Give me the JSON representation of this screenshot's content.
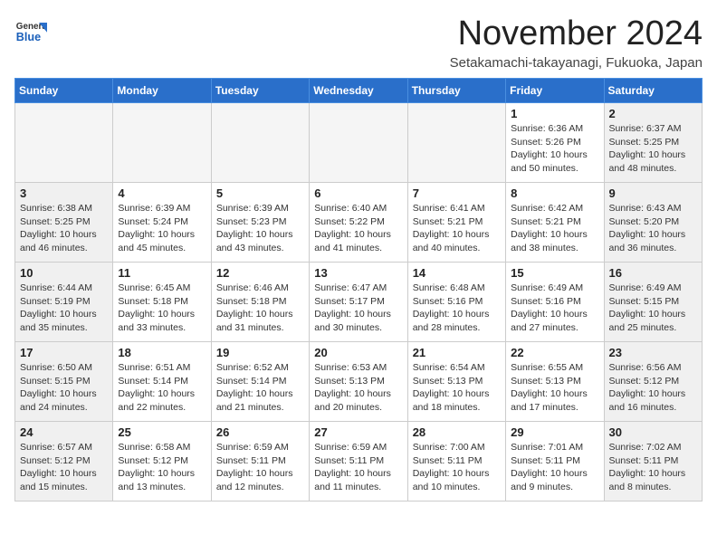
{
  "header": {
    "logo_general": "General",
    "logo_blue": "Blue",
    "month_title": "November 2024",
    "location": "Setakamachi-takayanagi, Fukuoka, Japan"
  },
  "days_of_week": [
    "Sunday",
    "Monday",
    "Tuesday",
    "Wednesday",
    "Thursday",
    "Friday",
    "Saturday"
  ],
  "weeks": [
    [
      {
        "day": "",
        "info": "",
        "empty": true
      },
      {
        "day": "",
        "info": "",
        "empty": true
      },
      {
        "day": "",
        "info": "",
        "empty": true
      },
      {
        "day": "",
        "info": "",
        "empty": true
      },
      {
        "day": "",
        "info": "",
        "empty": true
      },
      {
        "day": "1",
        "info": "Sunrise: 6:36 AM\nSunset: 5:26 PM\nDaylight: 10 hours and 50 minutes.",
        "empty": false
      },
      {
        "day": "2",
        "info": "Sunrise: 6:37 AM\nSunset: 5:25 PM\nDaylight: 10 hours and 48 minutes.",
        "empty": false
      }
    ],
    [
      {
        "day": "3",
        "info": "Sunrise: 6:38 AM\nSunset: 5:25 PM\nDaylight: 10 hours and 46 minutes.",
        "empty": false
      },
      {
        "day": "4",
        "info": "Sunrise: 6:39 AM\nSunset: 5:24 PM\nDaylight: 10 hours and 45 minutes.",
        "empty": false
      },
      {
        "day": "5",
        "info": "Sunrise: 6:39 AM\nSunset: 5:23 PM\nDaylight: 10 hours and 43 minutes.",
        "empty": false
      },
      {
        "day": "6",
        "info": "Sunrise: 6:40 AM\nSunset: 5:22 PM\nDaylight: 10 hours and 41 minutes.",
        "empty": false
      },
      {
        "day": "7",
        "info": "Sunrise: 6:41 AM\nSunset: 5:21 PM\nDaylight: 10 hours and 40 minutes.",
        "empty": false
      },
      {
        "day": "8",
        "info": "Sunrise: 6:42 AM\nSunset: 5:21 PM\nDaylight: 10 hours and 38 minutes.",
        "empty": false
      },
      {
        "day": "9",
        "info": "Sunrise: 6:43 AM\nSunset: 5:20 PM\nDaylight: 10 hours and 36 minutes.",
        "empty": false
      }
    ],
    [
      {
        "day": "10",
        "info": "Sunrise: 6:44 AM\nSunset: 5:19 PM\nDaylight: 10 hours and 35 minutes.",
        "empty": false
      },
      {
        "day": "11",
        "info": "Sunrise: 6:45 AM\nSunset: 5:18 PM\nDaylight: 10 hours and 33 minutes.",
        "empty": false
      },
      {
        "day": "12",
        "info": "Sunrise: 6:46 AM\nSunset: 5:18 PM\nDaylight: 10 hours and 31 minutes.",
        "empty": false
      },
      {
        "day": "13",
        "info": "Sunrise: 6:47 AM\nSunset: 5:17 PM\nDaylight: 10 hours and 30 minutes.",
        "empty": false
      },
      {
        "day": "14",
        "info": "Sunrise: 6:48 AM\nSunset: 5:16 PM\nDaylight: 10 hours and 28 minutes.",
        "empty": false
      },
      {
        "day": "15",
        "info": "Sunrise: 6:49 AM\nSunset: 5:16 PM\nDaylight: 10 hours and 27 minutes.",
        "empty": false
      },
      {
        "day": "16",
        "info": "Sunrise: 6:49 AM\nSunset: 5:15 PM\nDaylight: 10 hours and 25 minutes.",
        "empty": false
      }
    ],
    [
      {
        "day": "17",
        "info": "Sunrise: 6:50 AM\nSunset: 5:15 PM\nDaylight: 10 hours and 24 minutes.",
        "empty": false
      },
      {
        "day": "18",
        "info": "Sunrise: 6:51 AM\nSunset: 5:14 PM\nDaylight: 10 hours and 22 minutes.",
        "empty": false
      },
      {
        "day": "19",
        "info": "Sunrise: 6:52 AM\nSunset: 5:14 PM\nDaylight: 10 hours and 21 minutes.",
        "empty": false
      },
      {
        "day": "20",
        "info": "Sunrise: 6:53 AM\nSunset: 5:13 PM\nDaylight: 10 hours and 20 minutes.",
        "empty": false
      },
      {
        "day": "21",
        "info": "Sunrise: 6:54 AM\nSunset: 5:13 PM\nDaylight: 10 hours and 18 minutes.",
        "empty": false
      },
      {
        "day": "22",
        "info": "Sunrise: 6:55 AM\nSunset: 5:13 PM\nDaylight: 10 hours and 17 minutes.",
        "empty": false
      },
      {
        "day": "23",
        "info": "Sunrise: 6:56 AM\nSunset: 5:12 PM\nDaylight: 10 hours and 16 minutes.",
        "empty": false
      }
    ],
    [
      {
        "day": "24",
        "info": "Sunrise: 6:57 AM\nSunset: 5:12 PM\nDaylight: 10 hours and 15 minutes.",
        "empty": false
      },
      {
        "day": "25",
        "info": "Sunrise: 6:58 AM\nSunset: 5:12 PM\nDaylight: 10 hours and 13 minutes.",
        "empty": false
      },
      {
        "day": "26",
        "info": "Sunrise: 6:59 AM\nSunset: 5:11 PM\nDaylight: 10 hours and 12 minutes.",
        "empty": false
      },
      {
        "day": "27",
        "info": "Sunrise: 6:59 AM\nSunset: 5:11 PM\nDaylight: 10 hours and 11 minutes.",
        "empty": false
      },
      {
        "day": "28",
        "info": "Sunrise: 7:00 AM\nSunset: 5:11 PM\nDaylight: 10 hours and 10 minutes.",
        "empty": false
      },
      {
        "day": "29",
        "info": "Sunrise: 7:01 AM\nSunset: 5:11 PM\nDaylight: 10 hours and 9 minutes.",
        "empty": false
      },
      {
        "day": "30",
        "info": "Sunrise: 7:02 AM\nSunset: 5:11 PM\nDaylight: 10 hours and 8 minutes.",
        "empty": false
      }
    ]
  ]
}
